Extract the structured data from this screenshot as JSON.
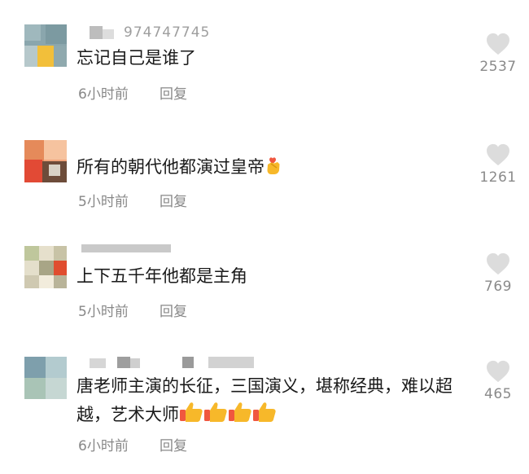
{
  "comments": [
    {
      "username": "974747745",
      "text": "忘记自己是谁了",
      "time": "6小时前",
      "reply": "回复",
      "likes": "2537"
    },
    {
      "username": "",
      "text": "所有的朝代他都演过皇帝",
      "time": "5小时前",
      "reply": "回复",
      "likes": "1261"
    },
    {
      "username": "",
      "text": "上下五千年他都是主角",
      "time": "5小时前",
      "reply": "回复",
      "likes": "769"
    },
    {
      "username": "",
      "text": "唐老师主演的长征，三国演义，堪称经典，难以超越，艺术大师",
      "time": "6小时前",
      "reply": "回复",
      "likes": "465"
    }
  ],
  "icons": {
    "like": "heart-icon",
    "finger_heart": "finger-heart-emoji",
    "thumbs_up": "thumbs-up-emoji"
  },
  "colors": {
    "text": "#1a1a1a",
    "meta": "#888888",
    "heart": "#dcdcdc",
    "emoji_thumb": "#f7b82a",
    "emoji_cuff": "#f0573f"
  }
}
